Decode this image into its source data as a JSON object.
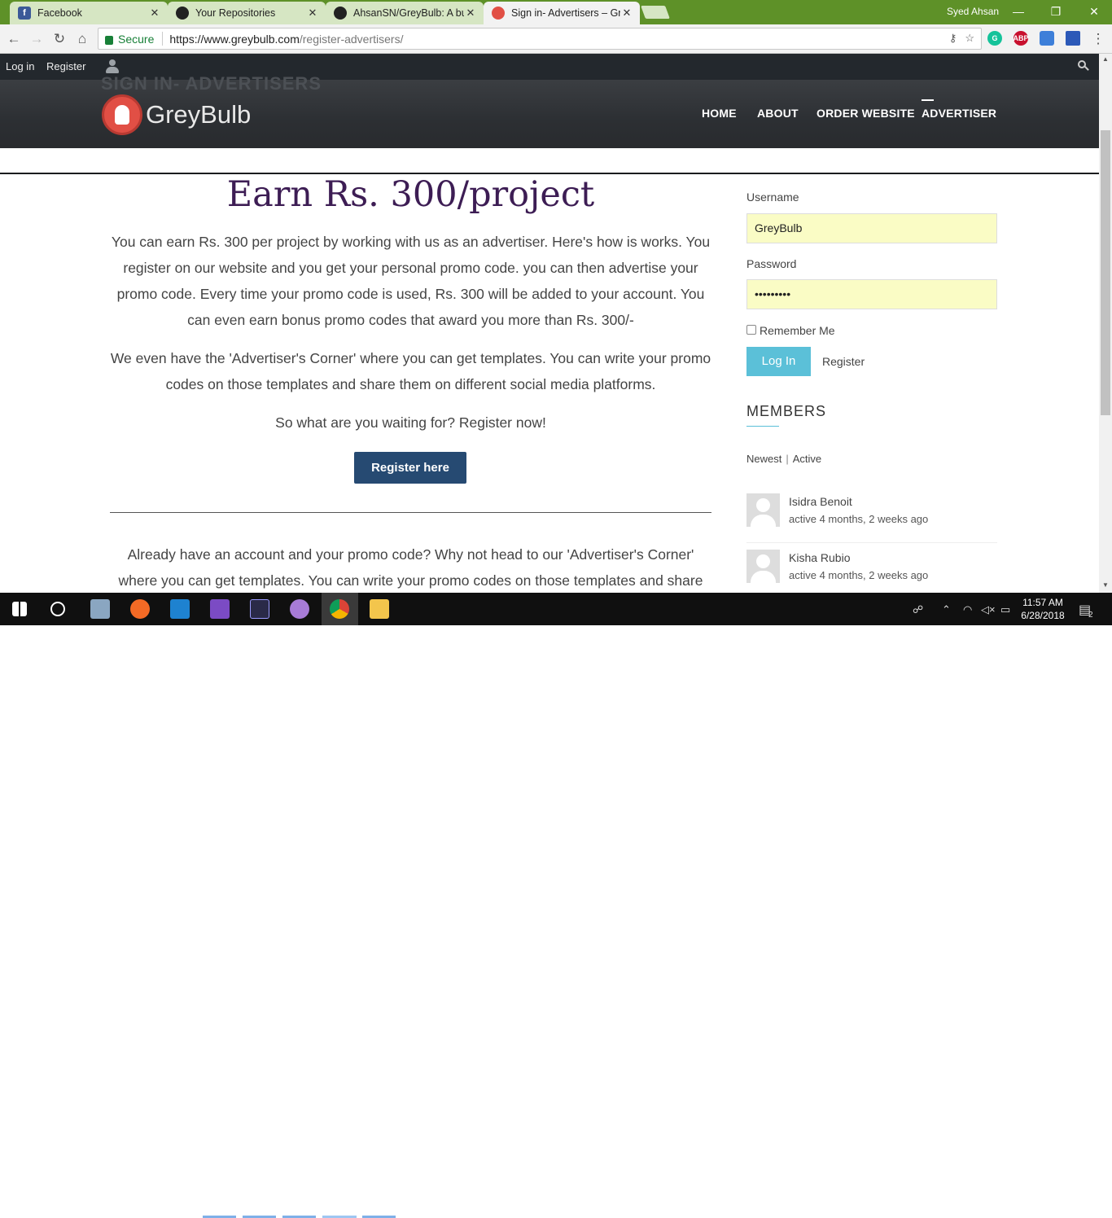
{
  "browser": {
    "tabs": [
      {
        "title": "Facebook",
        "icon": "facebook-icon",
        "color": "#3b5998"
      },
      {
        "title": "Your Repositories",
        "icon": "github-icon",
        "color": "#222222"
      },
      {
        "title": "AhsanSN/GreyBulb: A bu",
        "icon": "github-icon",
        "color": "#222222"
      },
      {
        "title": "Sign in- Advertisers – Gre",
        "icon": "greybulb-icon",
        "color": "#e14f45"
      }
    ],
    "profile_name": "Syed Ahsan",
    "security_label": "Secure",
    "url_host": "https://www.greybulb.com",
    "url_path": "/register-advertisers/",
    "accent": "#5e9128"
  },
  "admin_bar": {
    "login": "Log in",
    "register": "Register"
  },
  "hero": {
    "ghost_title": "SIGN IN- ADVERTISERS",
    "logo_text": "GreyBulb",
    "menu": [
      "HOME",
      "ABOUT",
      "ORDER WEBSITE",
      "ADVERTISER"
    ]
  },
  "main": {
    "headline": "Earn Rs. 300/project",
    "para1": "You can earn Rs. 300 per project by working with us as an advertiser. Here's how is works. You register on our website and you get your personal promo code. you can then advertise your promo code. Every time your promo code is used, Rs. 300 will be added to your account. You can even earn bonus promo codes that award you more than Rs. 300/-",
    "para2": "We even have the 'Advertiser's Corner' where you can get templates. You can write your promo codes on those templates and share them on different social media platforms.",
    "para3": "So what are you waiting for? Register now!",
    "register_button": "Register here",
    "para4": "Already have an account and your promo code? Why not head to our 'Advertiser's Corner' where you can get templates. You can write your promo codes on those templates and share"
  },
  "sidebar": {
    "username_label": "Username",
    "username_value": "GreyBulb",
    "password_label": "Password",
    "password_value": "•••••••••",
    "remember_label": "Remember Me",
    "login_button": "Log In",
    "register_link": "Register",
    "members_title": "MEMBERS",
    "tab_newest": "Newest",
    "tab_sep": "|",
    "tab_active": "Active",
    "members": [
      {
        "name": "Isidra Benoit",
        "activity": "active 4 months, 2 weeks ago"
      },
      {
        "name": "Kisha Rubio",
        "activity": "active 4 months, 2 weeks ago"
      }
    ],
    "accent": "#5bc0d8"
  },
  "taskbar": {
    "time": "11:57 AM",
    "date": "6/28/2018",
    "notifications": "2"
  }
}
